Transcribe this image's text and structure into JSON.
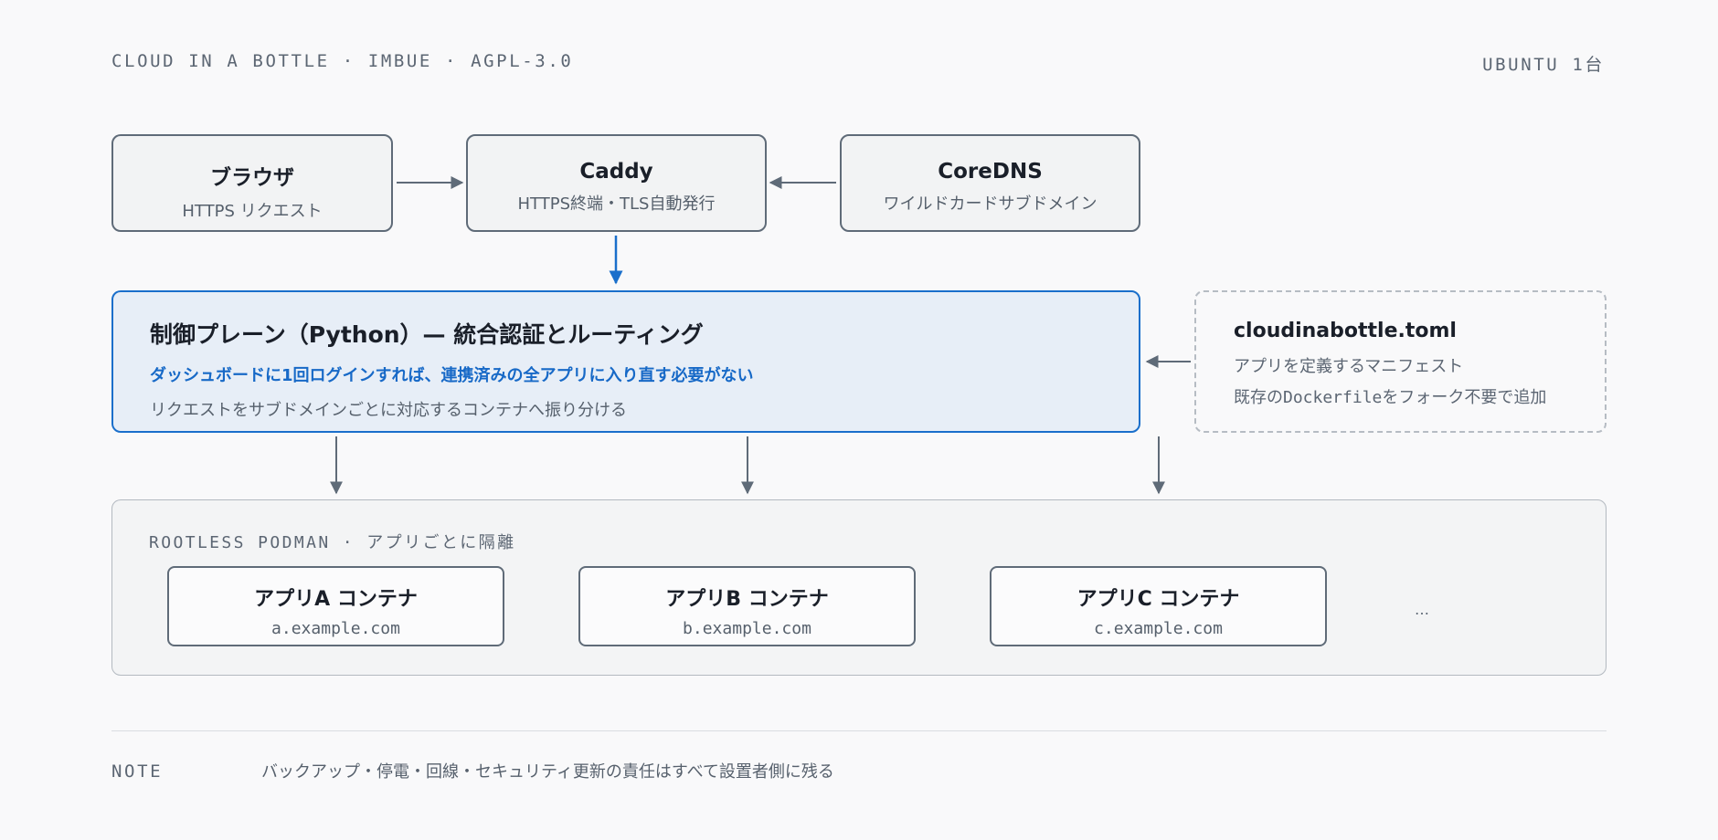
{
  "header": {
    "left": "CLOUD IN A BOTTLE · IMBUE · AGPL-3.0",
    "right": "UBUNTU 1台"
  },
  "top_nodes": {
    "browser": {
      "title": "ブラウザ",
      "subtitle": "HTTPS リクエスト"
    },
    "caddy": {
      "title": "Caddy",
      "subtitle": "HTTPS終端・TLS自動発行"
    },
    "coredns": {
      "title": "CoreDNS",
      "subtitle": "ワイルドカードサブドメイン"
    }
  },
  "control_plane": {
    "title": "制御プレーン（Python）— 統合認証とルーティング",
    "highlight": "ダッシュボードに1回ログインすれば、連携済みの全アプリに入り直す必要がない",
    "description": "リクエストをサブドメインごとに対応するコンテナへ振り分ける"
  },
  "manifest": {
    "title": "cloudinabottle.toml",
    "line1": "アプリを定義するマニフェスト",
    "line2_pre": "既存の",
    "line2_code": "Dockerfile",
    "line2_post": "をフォーク不要で追加"
  },
  "podman": {
    "label": "ROOTLESS PODMAN · アプリごとに隔離",
    "apps": [
      {
        "title": "アプリA コンテナ",
        "domain": "a.example.com"
      },
      {
        "title": "アプリB コンテナ",
        "domain": "b.example.com"
      },
      {
        "title": "アプリC コンテナ",
        "domain": "c.example.com"
      }
    ],
    "more": "…"
  },
  "note": {
    "label": "NOTE",
    "text": "バックアップ・停電・回線・セキュリティ更新の責任はすべて設置者側に残る"
  },
  "colors": {
    "accent": "#1a6fcb",
    "arrow": "#5f6b78",
    "border": "#5f6b78"
  }
}
